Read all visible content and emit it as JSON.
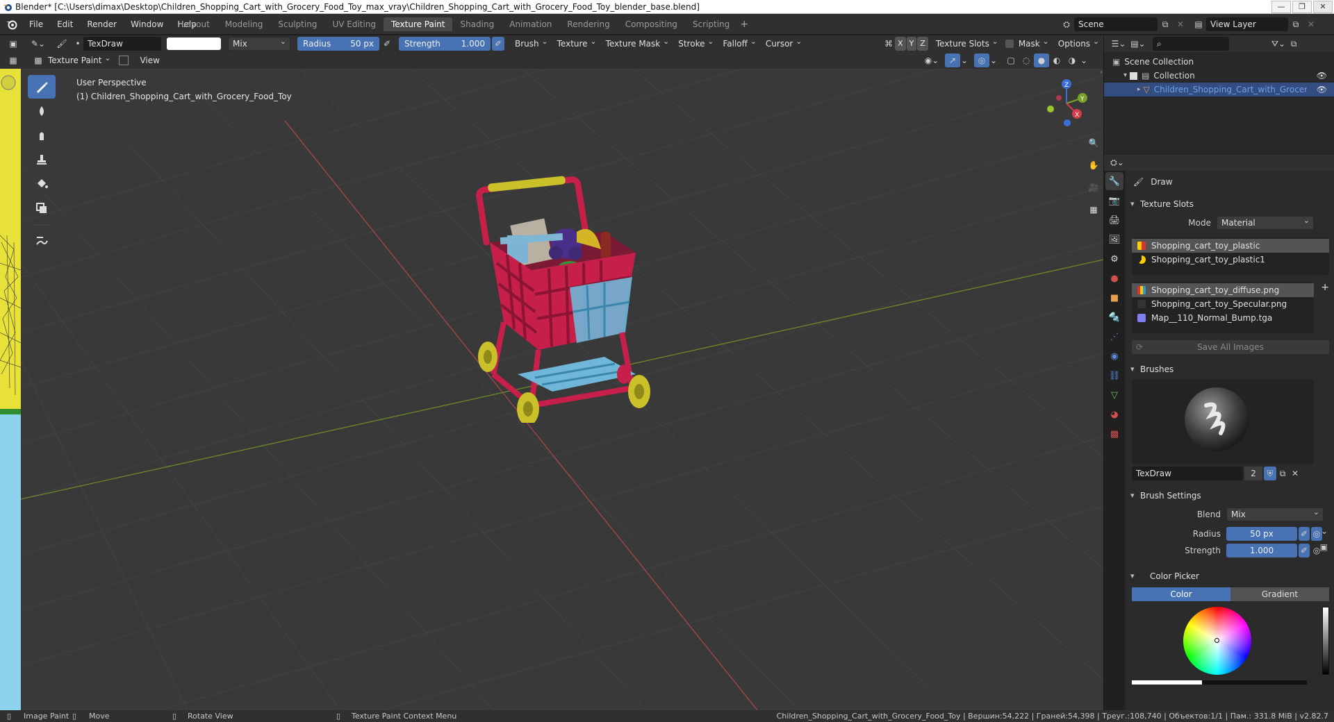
{
  "window": {
    "title": "Blender* [C:\\Users\\dimax\\Desktop\\Children_Shopping_Cart_with_Grocery_Food_Toy_max_vray\\Children_Shopping_Cart_with_Grocery_Food_Toy_blender_base.blend]",
    "buttons": [
      "—",
      "❐",
      "✕"
    ]
  },
  "menu": [
    "File",
    "Edit",
    "Render",
    "Window",
    "Help"
  ],
  "workspaces": [
    "Layout",
    "Modeling",
    "Sculpting",
    "UV Editing",
    "Texture Paint",
    "Shading",
    "Animation",
    "Rendering",
    "Compositing",
    "Scripting"
  ],
  "active_workspace": "Texture Paint",
  "scene": {
    "name": "Scene",
    "view_layer": "View Layer"
  },
  "tool_header": {
    "brush_name": "TexDraw",
    "blend": "Mix",
    "radius_label": "Radius",
    "radius_value": "50 px",
    "strength_label": "Strength",
    "strength_value": "1.000",
    "menus": [
      "Brush",
      "Texture",
      "Texture Mask",
      "Stroke",
      "Falloff",
      "Cursor"
    ],
    "axes": [
      "X",
      "Y",
      "Z"
    ],
    "texture_slots": "Texture Slots",
    "mask": "Mask",
    "options": "Options"
  },
  "mode_header": {
    "mode": "Texture Paint",
    "view": "View"
  },
  "viewport": {
    "perspective": "User Perspective",
    "object_label": "(1) Children_Shopping_Cart_with_Grocery_Food_Toy",
    "colors": {
      "bg": "#393939",
      "grid": "#454545",
      "x_axis": "#b04a4a",
      "y_axis": "#6d8a2c"
    }
  },
  "outliner": {
    "rows": [
      "Scene Collection",
      "Collection",
      "Children_Shopping_Cart_with_Grocery_Food"
    ]
  },
  "properties": {
    "tool_name": "Draw",
    "texture_slots": {
      "header": "Texture Slots",
      "mode_label": "Mode",
      "mode_value": "Material",
      "materials": [
        "Shopping_cart_toy_plastic",
        "Shopping_cart_toy_plastic1"
      ],
      "images": [
        "Shopping_cart_toy_diffuse.png",
        "Shopping_cart_toy_Specular.png",
        "Map__110_Normal_Bump.tga"
      ],
      "save_all": "Save All Images"
    },
    "brushes": {
      "header": "Brushes",
      "name": "TexDraw",
      "users": "2"
    },
    "brush_settings": {
      "header": "Brush Settings",
      "blend_label": "Blend",
      "blend_value": "Mix",
      "radius_label": "Radius",
      "radius_value": "50 px",
      "strength_label": "Strength",
      "strength_value": "1.000"
    },
    "color_picker": {
      "header": "Color Picker",
      "tabs": [
        "Color",
        "Gradient"
      ]
    }
  },
  "statusbar": {
    "left": [
      "Image Paint",
      "Move",
      "Rotate View",
      "Texture Paint Context Menu"
    ],
    "right": "Children_Shopping_Cart_with_Grocery_Food_Toy | Вершин:54,222 | Граней:54,398 | Треуг.:108,740 | Объектов:1/1 | Пам.: 331.8 MiB | v2.82.7"
  }
}
